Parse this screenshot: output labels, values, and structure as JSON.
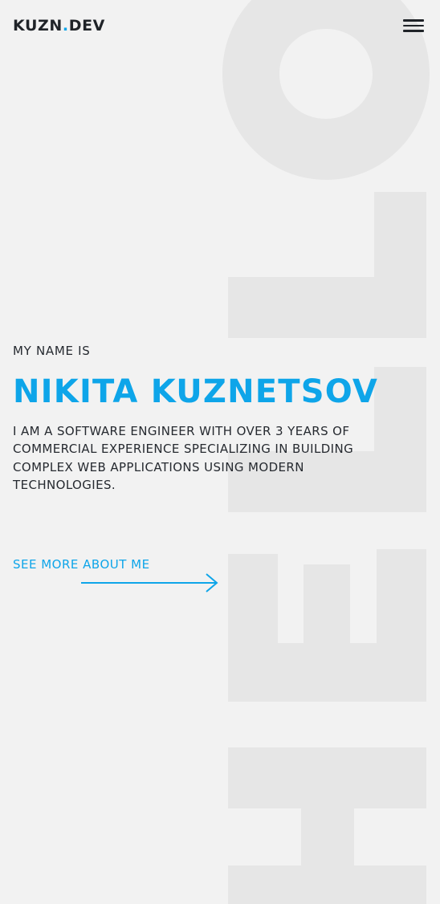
{
  "header": {
    "logo_part1": "KUZN",
    "logo_dot": ".",
    "logo_part2": "DEV",
    "menu_icon": "hamburger-menu-icon"
  },
  "hero": {
    "intro": "MY NAME IS",
    "name": "NIKITA KUZNETSOV",
    "description": "I AM A SOFTWARE ENGINEER WITH OVER 3 YEARS OF COMMERCIAL EXPERIENCE SPECIALIZING IN BUILDING COMPLEX WEB APPLICATIONS USING MODERN TECHNOLOGIES.",
    "cta_label": "SEE MORE ABOUT ME",
    "cta_icon": "arrow-right-icon"
  },
  "background": {
    "decorative_word": "HELLO"
  },
  "colors": {
    "accent": "#0ea5e9",
    "text": "#1f2328",
    "background": "#f2f2f2",
    "decorative": "#e6e6e6"
  }
}
